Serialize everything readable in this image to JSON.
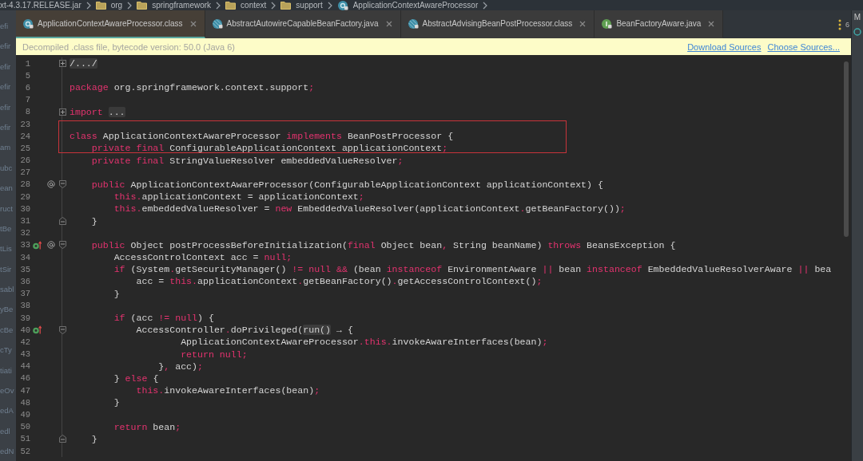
{
  "breadcrumb": [
    {
      "kind": "jar",
      "label": "xt-4.3.17.RELEASE.jar"
    },
    {
      "kind": "folder",
      "label": "org"
    },
    {
      "kind": "folder",
      "label": "springframework"
    },
    {
      "kind": "folder",
      "label": "context"
    },
    {
      "kind": "folder",
      "label": "support"
    },
    {
      "kind": "class",
      "label": "ApplicationContextAwareProcessor"
    }
  ],
  "sidebar": {
    "items": [
      "efi",
      "efir",
      "efir",
      "efir",
      "efir",
      "efir",
      "am",
      "ubc",
      "ean",
      "ruct",
      "tBe",
      "tLis",
      "tSir",
      "sabl",
      "yBe",
      "cBe",
      "cTy",
      "tiati",
      "eOv",
      "edA",
      "edl",
      "edN"
    ]
  },
  "tabs": [
    {
      "label": "ApplicationContextAwareProcessor.class",
      "kind": "class",
      "selected": true
    },
    {
      "label": "AbstractAutowireCapableBeanFactory.java",
      "kind": "abstract",
      "selected": false
    },
    {
      "label": "AbstractAdvisingBeanPostProcessor.class",
      "kind": "abstract",
      "selected": false
    },
    {
      "label": "BeanFactoryAware.java",
      "kind": "interface",
      "selected": false
    }
  ],
  "hidden_tabs_count": "6",
  "right_panel": {
    "label": "M"
  },
  "banner": {
    "text": "Decompiled .class file, bytecode version: 50.0 (Java 6)",
    "links": [
      "Download Sources",
      "Choose Sources..."
    ]
  },
  "editor": {
    "lines": [
      {
        "number": "1",
        "markers": [
          {
            "kind": "fold"
          }
        ],
        "tokens": [
          {
            "kind": "folded",
            "text": "/.../"
          }
        ]
      },
      {
        "number": "5"
      },
      {
        "number": "6",
        "tokens": [
          {
            "kind": "keyword",
            "text": "package"
          },
          {
            "kind": "plain",
            "text": " org.springframework.context.support"
          },
          {
            "kind": "symbol",
            "text": ";"
          }
        ]
      },
      {
        "number": "7"
      },
      {
        "number": "8",
        "markers": [
          {
            "kind": "fold"
          }
        ],
        "tokens": [
          {
            "kind": "keyword",
            "text": "import "
          },
          {
            "kind": "folded",
            "text": "..."
          }
        ]
      },
      {
        "number": "23"
      },
      {
        "number": "24",
        "tokens": [
          {
            "kind": "keyword",
            "text": "class"
          },
          {
            "kind": "plain",
            "text": " ApplicationContextAwareProcessor "
          },
          {
            "kind": "keyword",
            "text": "implements"
          },
          {
            "kind": "plain",
            "text": " BeanPostProcessor {"
          }
        ]
      },
      {
        "number": "25",
        "tokens": [
          {
            "kind": "keyword",
            "text": "    private final"
          },
          {
            "kind": "plain",
            "text": " ConfigurableApplicationContext applicationContext"
          },
          {
            "kind": "symbol",
            "text": ";"
          }
        ]
      },
      {
        "number": "26",
        "tokens": [
          {
            "kind": "keyword",
            "text": "    private final"
          },
          {
            "kind": "plain",
            "text": " StringValueResolver embeddedValueResolver"
          },
          {
            "kind": "symbol",
            "text": ";"
          }
        ]
      },
      {
        "number": "27"
      },
      {
        "number": "28",
        "markers": [
          {
            "kind": "annotation"
          },
          {
            "kind": "fold-start"
          }
        ],
        "tokens": [
          {
            "kind": "keyword",
            "text": "    public"
          },
          {
            "kind": "plain",
            "text": " ApplicationContextAwareProcessor(ConfigurableApplicationContext applicationContext) {"
          }
        ]
      },
      {
        "number": "29",
        "tokens": [
          {
            "kind": "keyword",
            "text": "        this"
          },
          {
            "kind": "symbol",
            "text": "."
          },
          {
            "kind": "plain",
            "text": "applicationContext = applicationContext"
          },
          {
            "kind": "symbol",
            "text": ";"
          }
        ]
      },
      {
        "number": "30",
        "tokens": [
          {
            "kind": "keyword",
            "text": "        this"
          },
          {
            "kind": "symbol",
            "text": "."
          },
          {
            "kind": "plain",
            "text": "embeddedValueResolver = "
          },
          {
            "kind": "keyword",
            "text": "new"
          },
          {
            "kind": "plain",
            "text": " EmbeddedValueResolver(applicationContext"
          },
          {
            "kind": "symbol",
            "text": "."
          },
          {
            "kind": "plain",
            "text": "getBeanFactory())"
          },
          {
            "kind": "symbol",
            "text": ";"
          }
        ]
      },
      {
        "number": "31",
        "markers": [
          {
            "kind": "fold-end"
          }
        ],
        "tokens": [
          {
            "kind": "plain",
            "text": "    }"
          }
        ]
      },
      {
        "number": "32"
      },
      {
        "number": "33",
        "markers": [
          {
            "kind": "override"
          },
          {
            "kind": "annotation"
          },
          {
            "kind": "fold-start"
          }
        ],
        "tokens": [
          {
            "kind": "keyword",
            "text": "    public"
          },
          {
            "kind": "plain",
            "text": " Object postProcessBeforeInitialization("
          },
          {
            "kind": "keyword",
            "text": "final"
          },
          {
            "kind": "plain",
            "text": " Object bean"
          },
          {
            "kind": "symbol",
            "text": ","
          },
          {
            "kind": "plain",
            "text": " String beanName) "
          },
          {
            "kind": "keyword",
            "text": "throws"
          },
          {
            "kind": "plain",
            "text": " BeansException {"
          }
        ]
      },
      {
        "number": "34",
        "tokens": [
          {
            "kind": "plain",
            "text": "        AccessControlContext acc = "
          },
          {
            "kind": "keyword",
            "text": "null"
          },
          {
            "kind": "symbol",
            "text": ";"
          }
        ]
      },
      {
        "number": "35",
        "tokens": [
          {
            "kind": "keyword",
            "text": "        if"
          },
          {
            "kind": "plain",
            "text": " (System"
          },
          {
            "kind": "symbol",
            "text": "."
          },
          {
            "kind": "plain",
            "text": "getSecurityManager() "
          },
          {
            "kind": "symbol",
            "text": "!="
          },
          {
            "kind": "keyword",
            "text": " null "
          },
          {
            "kind": "symbol",
            "text": "&&"
          },
          {
            "kind": "plain",
            "text": " (bean "
          },
          {
            "kind": "keyword",
            "text": "instanceof"
          },
          {
            "kind": "plain",
            "text": " EnvironmentAware "
          },
          {
            "kind": "symbol",
            "text": "||"
          },
          {
            "kind": "plain",
            "text": " bean "
          },
          {
            "kind": "keyword",
            "text": "instanceof"
          },
          {
            "kind": "plain",
            "text": " EmbeddedValueResolverAware "
          },
          {
            "kind": "symbol",
            "text": "||"
          },
          {
            "kind": "plain",
            "text": " bea"
          }
        ]
      },
      {
        "number": "36",
        "tokens": [
          {
            "kind": "plain",
            "text": "            acc = "
          },
          {
            "kind": "keyword",
            "text": "this"
          },
          {
            "kind": "symbol",
            "text": "."
          },
          {
            "kind": "plain",
            "text": "applicationContext"
          },
          {
            "kind": "symbol",
            "text": "."
          },
          {
            "kind": "plain",
            "text": "getBeanFactory()"
          },
          {
            "kind": "symbol",
            "text": "."
          },
          {
            "kind": "plain",
            "text": "getAccessControlContext()"
          },
          {
            "kind": "symbol",
            "text": ";"
          }
        ]
      },
      {
        "number": "37",
        "tokens": [
          {
            "kind": "plain",
            "text": "        }"
          }
        ]
      },
      {
        "number": "38"
      },
      {
        "number": "39",
        "tokens": [
          {
            "kind": "keyword",
            "text": "        if"
          },
          {
            "kind": "plain",
            "text": " (acc "
          },
          {
            "kind": "symbol",
            "text": "!="
          },
          {
            "kind": "keyword",
            "text": " null"
          },
          {
            "kind": "plain",
            "text": ") {"
          }
        ]
      },
      {
        "number": "40",
        "markers": [
          {
            "kind": "override"
          },
          {
            "kind": "fold-start"
          }
        ],
        "tokens": [
          {
            "kind": "plain",
            "text": "            AccessController"
          },
          {
            "kind": "symbol",
            "text": "."
          },
          {
            "kind": "plain",
            "text": "doPrivileged("
          },
          {
            "kind": "hint",
            "text": "run()"
          },
          {
            "kind": "plain",
            "text": " → {"
          }
        ]
      },
      {
        "number": "42",
        "tokens": [
          {
            "kind": "plain",
            "text": "                    ApplicationContextAwareProcessor"
          },
          {
            "kind": "symbol",
            "text": "."
          },
          {
            "kind": "keyword",
            "text": "this"
          },
          {
            "kind": "symbol",
            "text": "."
          },
          {
            "kind": "plain",
            "text": "invokeAwareInterfaces(bean)"
          },
          {
            "kind": "symbol",
            "text": ";"
          }
        ]
      },
      {
        "number": "43",
        "tokens": [
          {
            "kind": "keyword",
            "text": "                    return null"
          },
          {
            "kind": "symbol",
            "text": ";"
          }
        ]
      },
      {
        "number": "44",
        "tokens": [
          {
            "kind": "plain",
            "text": "                }"
          },
          {
            "kind": "symbol",
            "text": ","
          },
          {
            "kind": "plain",
            "text": " acc)"
          },
          {
            "kind": "symbol",
            "text": ";"
          }
        ]
      },
      {
        "number": "46",
        "tokens": [
          {
            "kind": "plain",
            "text": "        } "
          },
          {
            "kind": "keyword",
            "text": "else"
          },
          {
            "kind": "plain",
            "text": " {"
          }
        ]
      },
      {
        "number": "47",
        "tokens": [
          {
            "kind": "keyword",
            "text": "            this"
          },
          {
            "kind": "symbol",
            "text": "."
          },
          {
            "kind": "plain",
            "text": "invokeAwareInterfaces(bean)"
          },
          {
            "kind": "symbol",
            "text": ";"
          }
        ]
      },
      {
        "number": "48",
        "tokens": [
          {
            "kind": "plain",
            "text": "        }"
          }
        ]
      },
      {
        "number": "49"
      },
      {
        "number": "50",
        "tokens": [
          {
            "kind": "keyword",
            "text": "        return"
          },
          {
            "kind": "plain",
            "text": " bean"
          },
          {
            "kind": "symbol",
            "text": ";"
          }
        ]
      },
      {
        "number": "51",
        "markers": [
          {
            "kind": "fold-end"
          }
        ],
        "tokens": [
          {
            "kind": "plain",
            "text": "    }"
          }
        ]
      },
      {
        "number": "52"
      }
    ]
  }
}
